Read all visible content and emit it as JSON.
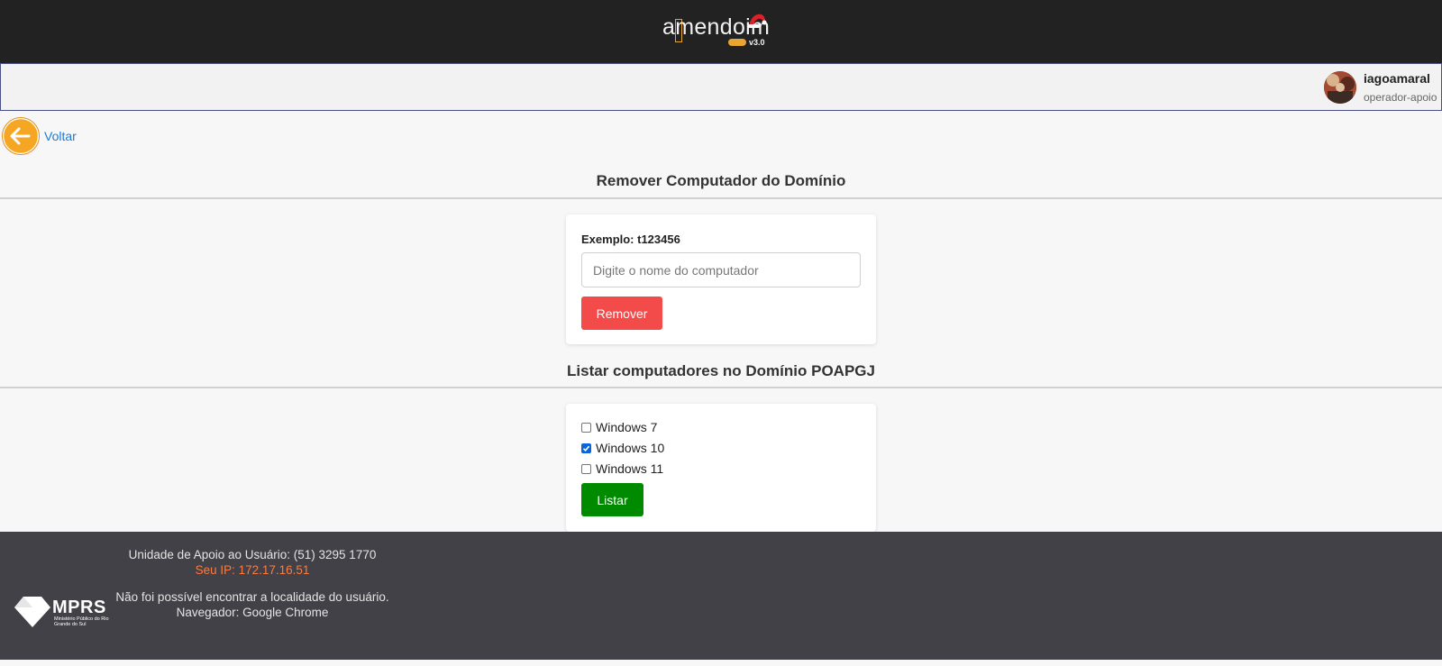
{
  "header": {
    "logo_text": "amendoim",
    "logo_version": "v3.0"
  },
  "user": {
    "name": "iagoamaral",
    "role": "operador-apoio"
  },
  "nav": {
    "back_label": "Voltar"
  },
  "remove_section": {
    "title": "Remover Computador do Domínio",
    "example_label": "Exemplo: t123456",
    "input_placeholder": "Digite o nome do computador",
    "input_value": "",
    "button_label": "Remover"
  },
  "list_section": {
    "title": "Listar computadores no Domínio POAPGJ",
    "options": [
      {
        "label": "Windows 7",
        "checked": false
      },
      {
        "label": "Windows 10",
        "checked": true
      },
      {
        "label": "Windows 11",
        "checked": false
      }
    ],
    "button_label": "Listar"
  },
  "footer": {
    "support": "Unidade de Apoio ao Usuário: (51) 3295 1770",
    "ip": "Seu IP: 172.17.16.51",
    "location": "Não foi possível encontrar a localidade do usuário.",
    "browser": "Navegador: Google Chrome",
    "org_short": "MPRS",
    "org_full": "Ministério Público do Rio Grande do Sul"
  },
  "colors": {
    "header_bg": "#222222",
    "remove_button": "#f34a4a",
    "list_button": "#008a00",
    "link": "#1a7cd4",
    "back_icon": "#f5a623",
    "footer_bg": "#424147",
    "ip_text": "#ff7a3d"
  }
}
